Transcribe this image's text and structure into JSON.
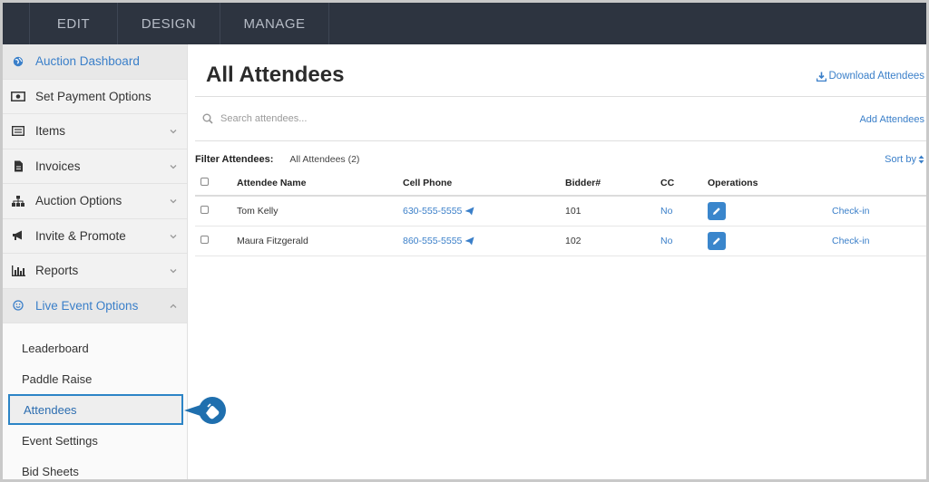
{
  "topnav": {
    "tabs": [
      "EDIT",
      "DESIGN",
      "MANAGE"
    ]
  },
  "sidebar": {
    "items": [
      {
        "label": "Auction Dashboard",
        "icon": "globe-icon",
        "active": true
      },
      {
        "label": "Set Payment Options",
        "icon": "money-icon"
      },
      {
        "label": "Items",
        "icon": "list-icon",
        "chevron": "down"
      },
      {
        "label": "Invoices",
        "icon": "document-icon",
        "chevron": "down"
      },
      {
        "label": "Auction Options",
        "icon": "sitemap-icon",
        "chevron": "down"
      },
      {
        "label": "Invite & Promote",
        "icon": "megaphone-icon",
        "chevron": "down"
      },
      {
        "label": "Reports",
        "icon": "bar-chart-icon",
        "chevron": "down"
      },
      {
        "label": "Live Event Options",
        "icon": "smiley-icon",
        "chevron": "up",
        "active": true
      }
    ],
    "subitems": [
      "Leaderboard",
      "Paddle Raise",
      "Attendees",
      "Event Settings",
      "Bid Sheets"
    ],
    "selected_subitem": "Attendees"
  },
  "main": {
    "title": "All Attendees",
    "download_label": "Download Attendees",
    "search_placeholder": "Search attendees...",
    "add_label": "Add Attendees",
    "filter_label": "Filter Attendees:",
    "filter_value": "All Attendees (2)",
    "sort_label": "Sort by",
    "columns": [
      "Attendee Name",
      "Cell Phone",
      "Bidder#",
      "CC",
      "Operations"
    ],
    "rows": [
      {
        "name": "Tom Kelly",
        "phone": "630-555-5555",
        "bidder": "101",
        "cc": "No",
        "checkin": "Check-in"
      },
      {
        "name": "Maura Fitzgerald",
        "phone": "860-555-5555",
        "bidder": "102",
        "cc": "No",
        "checkin": "Check-in"
      }
    ]
  },
  "colors": {
    "accent": "#3a7fc9",
    "nav_bg": "#2d3440",
    "highlight": "#2c84c6"
  }
}
